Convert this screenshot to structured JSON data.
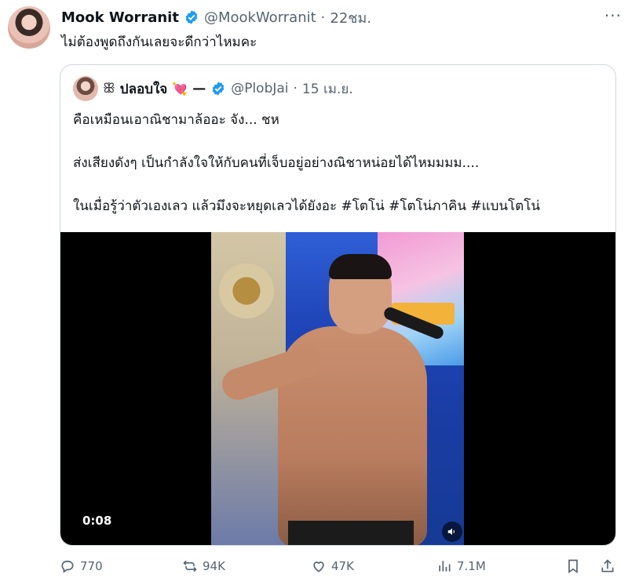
{
  "tweet": {
    "author_name": "Mook Worranit",
    "handle": "@MookWorranit",
    "dot": "·",
    "time": "22ชม.",
    "more_label": "···",
    "text": "ไม่ต้องพูดถึงกันเลยจะดีกว่าไหมคะ"
  },
  "quote": {
    "name_prefix": "ꕥ",
    "author_name": "ปลอบใจ",
    "heart": "💘",
    "dash": "—",
    "handle": "@PlobJai",
    "dot": "·",
    "time": "15 เม.ย.",
    "paragraphs": [
      "คือเหมือนเอาณิชามาล้ออะ จัง... ชห",
      "ส่งเสียงดังๆ เป็นกำลังใจให้กับคนที่เจ็บอยู่อย่างณิชาหน่อยได้ไหมมมม....",
      "ในเมื่อรู้ว่าตัวเองเลว แล้วมึงจะหยุดเลวได้ยังอะ #โตโน่ #โตโน่ภาคิน #แบนโตโน่"
    ],
    "video_time": "0:08"
  },
  "actions": {
    "replies": "770",
    "retweets": "94K",
    "likes": "47K",
    "views": "7.1M"
  },
  "colors": {
    "verified": "#1d9bf0",
    "muted": "#536471",
    "border": "#cfd9de"
  }
}
